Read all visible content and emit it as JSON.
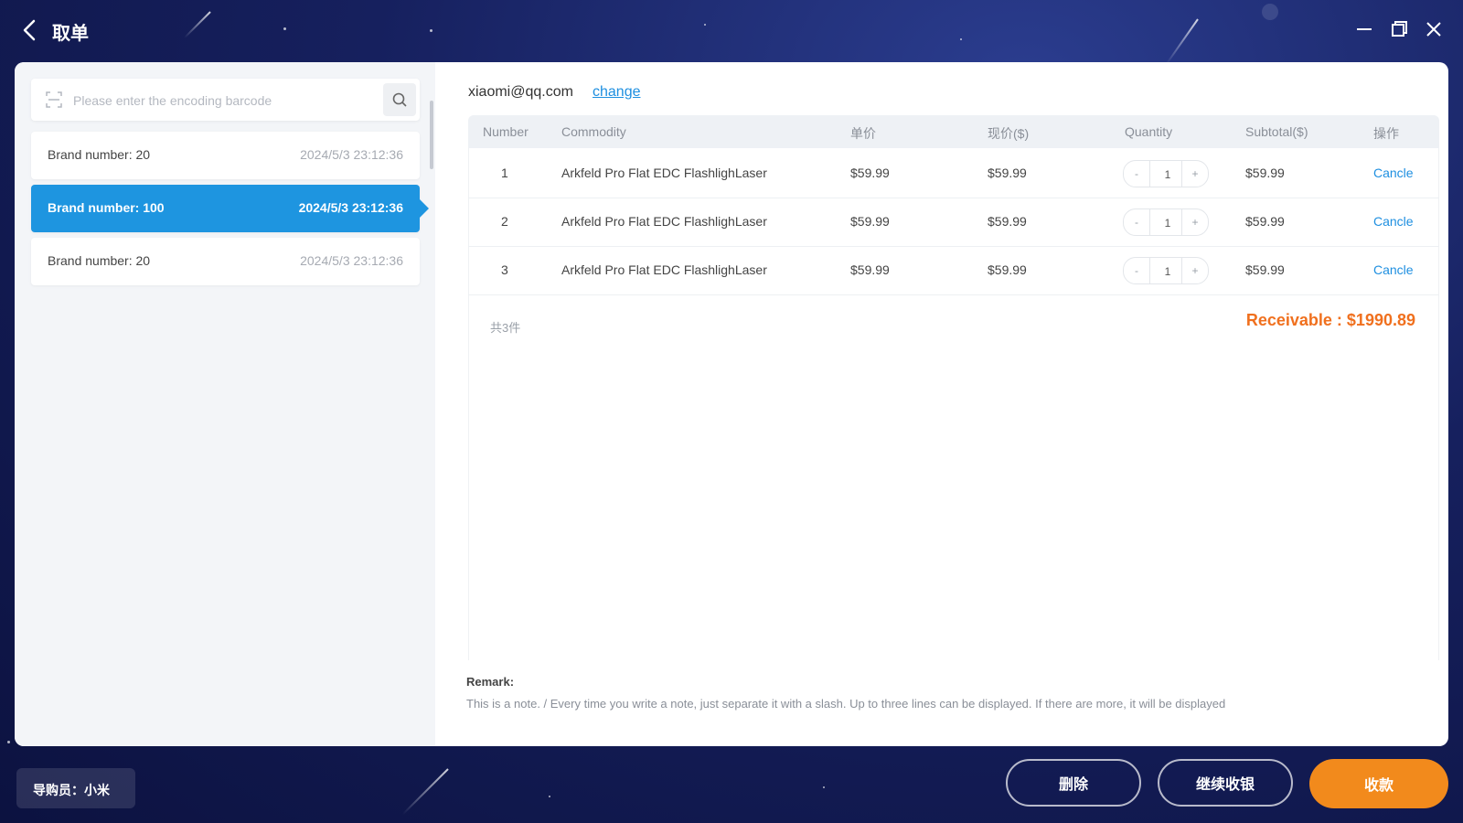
{
  "window": {
    "title": "取单"
  },
  "search": {
    "placeholder": "Please enter the encoding barcode"
  },
  "orders": [
    {
      "brand": "Brand number: 20",
      "time": "2024/5/3 23:12:36",
      "active": false
    },
    {
      "brand": "Brand number: 100",
      "time": "2024/5/3 23:12:36",
      "active": true
    },
    {
      "brand": "Brand number: 20",
      "time": "2024/5/3 23:12:36",
      "active": false
    }
  ],
  "customer": {
    "email": "xiaomi@qq.com",
    "change_label": "change"
  },
  "table": {
    "headers": [
      "Number",
      "Commodity",
      "单价",
      "现价($)",
      "Quantity",
      "Subtotal($)",
      "操作"
    ],
    "rows": [
      {
        "number": "1",
        "commodity": "Arkfeld Pro Flat EDC FlashlighLaser",
        "unit_price": "$59.99",
        "current_price": "$59.99",
        "quantity": "1",
        "subtotal": "$59.99",
        "action": "Cancle"
      },
      {
        "number": "2",
        "commodity": "Arkfeld Pro Flat EDC FlashlighLaser",
        "unit_price": "$59.99",
        "current_price": "$59.99",
        "quantity": "1",
        "subtotal": "$59.99",
        "action": "Cancle"
      },
      {
        "number": "3",
        "commodity": "Arkfeld Pro Flat EDC FlashlighLaser",
        "unit_price": "$59.99",
        "current_price": "$59.99",
        "quantity": "1",
        "subtotal": "$59.99",
        "action": "Cancle"
      }
    ],
    "stepper_minus": "-",
    "stepper_plus": "+"
  },
  "summary": {
    "count": "共3件",
    "receivable": "Receivable : $1990.89"
  },
  "remark": {
    "label": "Remark:",
    "text": "This is a note. / Every time you write a note, just separate it with a slash. Up to three lines can be displayed. If there are more, it will be displayed"
  },
  "footer": {
    "operator": "导购员：小米",
    "delete_label": "删除",
    "continue_label": "继续收银",
    "collect_label": "收款"
  },
  "colors": {
    "accent": "#1e95e0",
    "receivable": "#f0701e",
    "collect_button": "#f28a1c"
  }
}
